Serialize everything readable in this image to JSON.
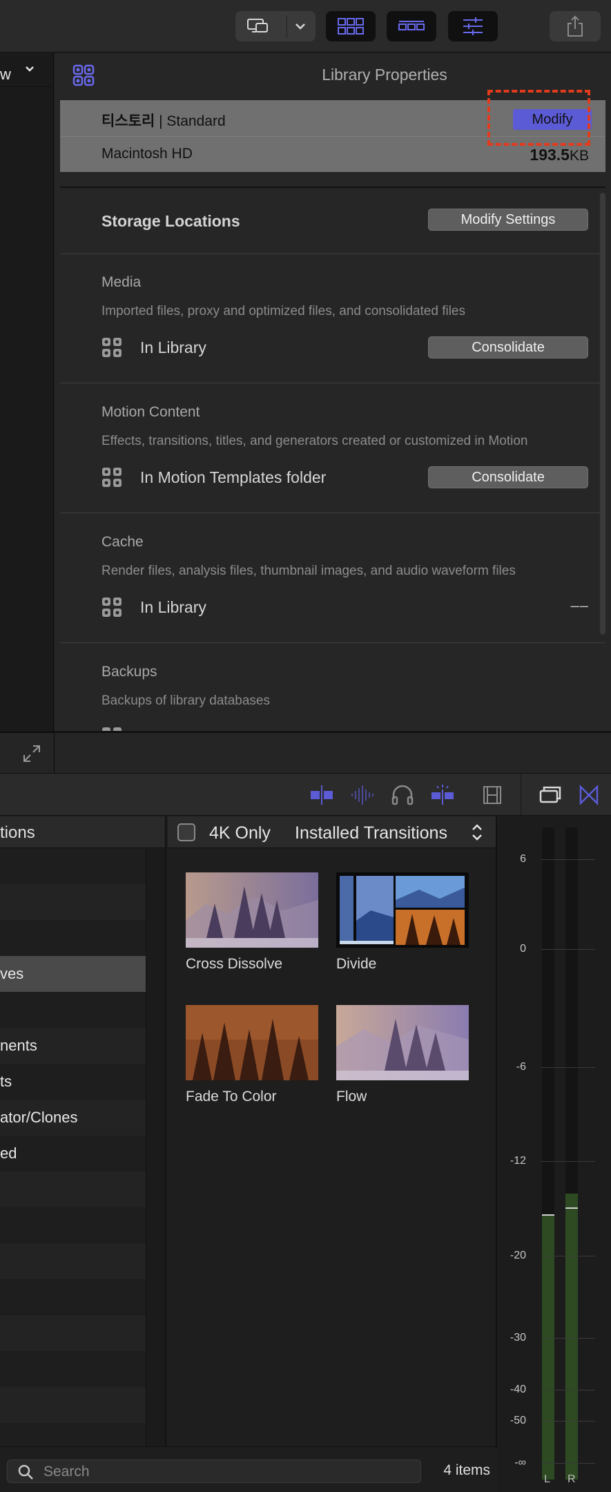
{
  "toolbar": {
    "buttons": [
      "display-options-icon",
      "chevron-down-icon",
      "browser-grid-icon",
      "timeline-icon",
      "inspector-sliders-icon",
      "share-icon"
    ],
    "accent": "#5b5bd6"
  },
  "left_strip": {
    "view_label": "w"
  },
  "inspector": {
    "title": "Library Properties",
    "library_name": "티스토리",
    "library_format": "| Standard",
    "modify_label": "Modify",
    "volume": "Macintosh HD",
    "size_value": "193.5",
    "size_unit": "KB",
    "storage_title": "Storage Locations",
    "modify_settings_label": "Modify Settings",
    "media_title": "Media",
    "media_desc": "Imported files, proxy and optimized files, and consolidated files",
    "media_location": "In Library",
    "media_button": "Consolidate",
    "motion_title": "Motion Content",
    "motion_desc": "Effects, transitions, titles, and generators created or customized in Motion",
    "motion_location": "In Motion Templates folder",
    "motion_button": "Consolidate",
    "cache_title": "Cache",
    "cache_desc": "Render files, analysis files, thumbnail images, and audio waveform files",
    "cache_location": "In Library",
    "cache_value": "––",
    "backups_title": "Backups",
    "backups_desc": "Backups of library databases"
  },
  "browser": {
    "list_header": "tions",
    "list_items": [
      "",
      "",
      "",
      "ves",
      "",
      "nents",
      "ts",
      "ator/Clones",
      "ed",
      "",
      "",
      "",
      "",
      "",
      "",
      "",
      ""
    ],
    "selected_index": 3,
    "four_k_label": "4K Only",
    "installed_label": "Installed Transitions",
    "transitions": [
      {
        "name": "Cross Dissolve"
      },
      {
        "name": "Divide"
      },
      {
        "name": "Fade To Color"
      },
      {
        "name": "Flow"
      }
    ],
    "search_placeholder": "Search",
    "items_count": "4 items"
  },
  "meter": {
    "scale": [
      "6",
      "0",
      "-6",
      "-12",
      "-20",
      "-30",
      "-40",
      "-50",
      "-∞"
    ],
    "left_label": "L",
    "right_label": "R",
    "fill_color": "#2d4a22"
  }
}
